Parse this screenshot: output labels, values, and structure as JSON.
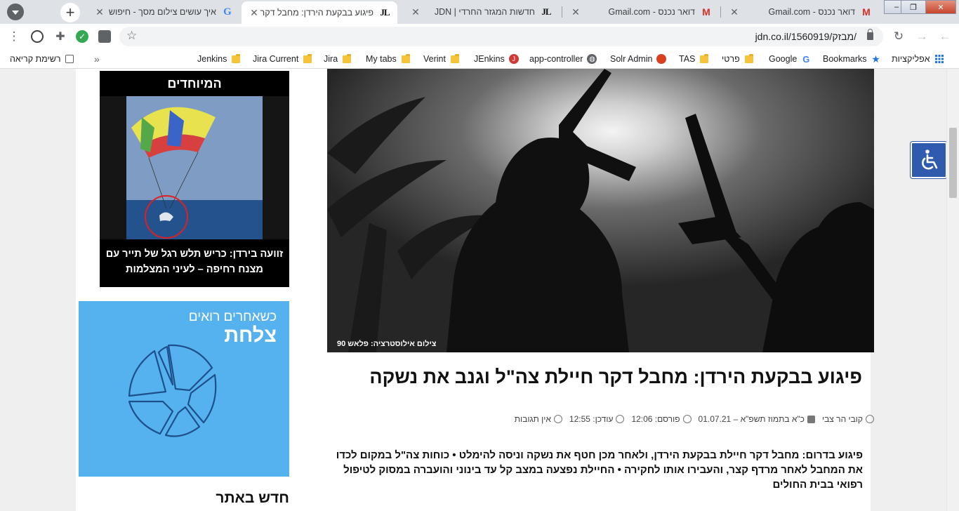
{
  "browser": {
    "tabs": [
      {
        "title": "דואר נכנס - Gmail.com",
        "favicon": "gmail-icon"
      },
      {
        "title": "דואר נכנס - Gmail.com",
        "favicon": "gmail-icon"
      },
      {
        "title": "חדשות המגזר החרדי | JDN",
        "favicon": "jdn-icon"
      },
      {
        "title": "פיגוע בבקעת הירדן: מחבל דקר חי",
        "favicon": "jdn-icon",
        "active": true
      },
      {
        "title": "איך עושים צילום מסך - חיפוש",
        "favicon": "google-icon"
      }
    ],
    "new_tab_label": "+",
    "address": {
      "url": "jdn.co.il/1560919/מבזק/"
    },
    "window_controls": {
      "minimize": "‒",
      "maximize": "❐",
      "close": "✕"
    }
  },
  "bookmarks": {
    "items": [
      {
        "label": "אפליקציות",
        "icon": "apps-grid-icon"
      },
      {
        "label": "Bookmarks",
        "icon": "star-icon"
      },
      {
        "label": "Google",
        "icon": "google-icon"
      },
      {
        "label": "פרטי",
        "icon": "folder-icon"
      },
      {
        "label": "TAS",
        "icon": "folder-icon"
      },
      {
        "label": "Solr Admin",
        "icon": "solr-icon"
      },
      {
        "label": "app-controller",
        "icon": "globe-icon"
      },
      {
        "label": "JEnkins",
        "icon": "jenkins-icon"
      },
      {
        "label": "Verint",
        "icon": "folder-icon"
      },
      {
        "label": "My tabs",
        "icon": "folder-icon"
      },
      {
        "label": "Jira",
        "icon": "folder-icon"
      },
      {
        "label": "Jira Current",
        "icon": "folder-icon"
      },
      {
        "label": "Jenkins",
        "icon": "folder-icon"
      }
    ],
    "overflow": "»",
    "reading_list": "רשימת קריאה"
  },
  "page": {
    "special": {
      "heading": "המיוחדים",
      "caption": "זוועה בירדן: כריש תלש רגל של תייר עם מצנח רחיפה – לעיני המצלמות"
    },
    "ad": {
      "line1": "כשאחרים רואים",
      "line2": "צלחת"
    },
    "new_on_site": "חדש באתר",
    "article": {
      "image_caption": "צילום אילוסטרציה: פלאש 90",
      "title": "פיגוע בבקעת הירדן: מחבל דקר חיילת צה\"ל וגנב את נשקה",
      "meta": {
        "author": "קובי הר צבי",
        "date": "כ\"א בתמוז תשפ\"א – 01.07.21",
        "published": "פורסם: 12:06",
        "updated": "עודכן: 12:55",
        "comments": "אין תגובות"
      },
      "lead": "פיגוע בדרום: מחבל דקר חיילת בבקעת הירדן, ולאחר מכן חטף את נשקה וניסה להימלט • כוחות צה\"ל במקום לכדו את המחבל לאחר מרדף קצר, והעבירו אותו לחקירה • החיילת נפצעה במצב קל עד בינוני והועברה במסוק לטיפול רפואי בבית החולים"
    }
  },
  "colors": {
    "accessibility_button": "#2f5aae",
    "ad_background": "#55b2ee",
    "tab_strip": "#dee1e6"
  }
}
